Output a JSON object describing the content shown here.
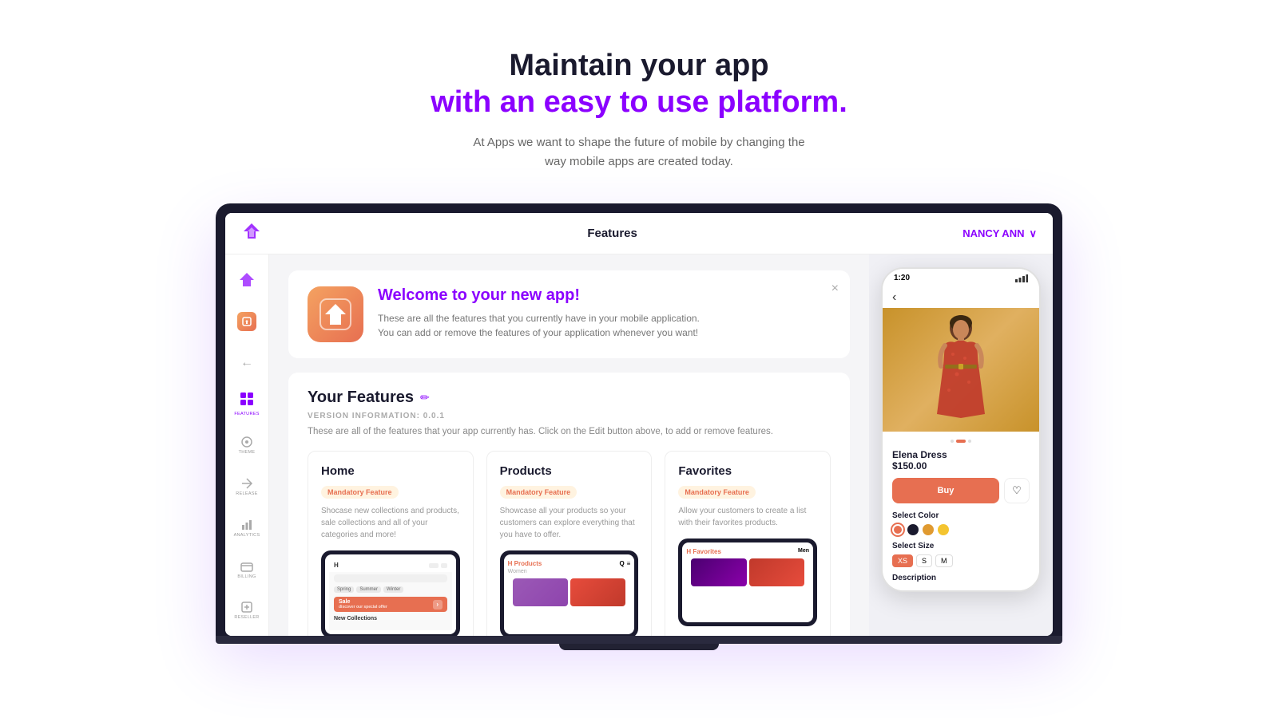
{
  "hero": {
    "title_line1": "Maintain your app",
    "title_line2": "with an easy to use platform.",
    "subtitle": "At Apps we want to shape the future of mobile by changing the\nway mobile apps are created today."
  },
  "app": {
    "header": {
      "title": "Features",
      "user": "NANCY ANN"
    },
    "sidebar": {
      "items": [
        {
          "icon": "⬡",
          "label": ""
        },
        {
          "icon": "N",
          "label": ""
        },
        {
          "icon": "←",
          "label": ""
        },
        {
          "icon": "⊞",
          "label": "FEATURES"
        },
        {
          "icon": "◎",
          "label": "THEME"
        },
        {
          "icon": "✈",
          "label": "RELEASE"
        },
        {
          "icon": "▦",
          "label": "ANALYTICS"
        },
        {
          "icon": "⬓",
          "label": "BILLING"
        },
        {
          "icon": "⊡",
          "label": "RESELLER"
        }
      ]
    },
    "welcome": {
      "heading_start": "Welcome to your new ",
      "heading_accent": "app!",
      "description": "These are all the features that you currently have in your mobile application. You can add or remove the features of your application whenever you want!"
    },
    "features_section": {
      "title": "Your Features",
      "version_label": "VERSION INFORMATION: 0.0.1",
      "description": "These are all of the features that your app currently has. Click on the Edit button above, to add or remove features.",
      "cards": [
        {
          "title": "Home",
          "badge": "Mandatory Feature",
          "description": "Shocase new collections and products, sale collections and all of your categories and more!"
        },
        {
          "title": "Products",
          "badge": "Mandatory Feature",
          "description": "Showcase all your products so your customers can explore everything that you have to offer."
        },
        {
          "title": "Favorites",
          "badge": "Mandatory Feature",
          "description": "Allow your customers to create a list with their favorites products."
        }
      ]
    },
    "phone_preview": {
      "time": "1:20",
      "product_name": "Elena Dress",
      "product_price": "$150.00",
      "buy_label": "Buy",
      "select_color_label": "Select Color",
      "select_size_label": "Select Size",
      "description_label": "Description",
      "sizes": [
        "XS",
        "S",
        "M"
      ],
      "colors": [
        "#e76f51",
        "#1a1a2e",
        "#e09a30",
        "#f4c430"
      ]
    }
  },
  "icons": {
    "close": "×",
    "chevron_down": "∨",
    "edit": "✏",
    "back": "‹",
    "heart": "♡"
  }
}
